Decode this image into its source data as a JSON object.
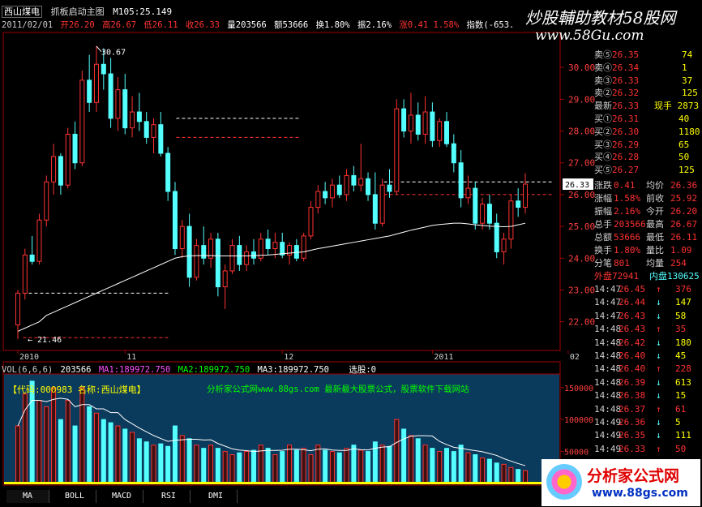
{
  "header": {
    "title": "西山煤电",
    "formula_name": "抓板启动主图",
    "ma_label": "M105:25.149",
    "date": "2011/02/01",
    "open": "开26.20",
    "high": "高26.67",
    "low": "低26.11",
    "close": "收26.33",
    "volume": "量203566",
    "amount": "额53666",
    "turnover": "换1.80%",
    "amplitude": "振2.16%",
    "change": "涨0.41",
    "change_pct": "1.58%",
    "index": "指数(-653."
  },
  "watermark": {
    "title": "炒股輔助教材58股网",
    "url": "www.58Gu.com",
    "brand": "分析家公式网",
    "brand_url": "www.88gs.com"
  },
  "chart_data": [
    {
      "type": "candlestick",
      "y_ticks": [
        "30.00",
        "29.00",
        "28.00",
        "27.00",
        "26.00",
        "25.00",
        "24.00",
        "23.00",
        "22.00"
      ],
      "x_ticks": [
        "2010",
        "11",
        "12",
        "2011",
        "02"
      ],
      "x_tick_index": [
        0,
        15,
        37,
        58,
        77
      ],
      "ylim": [
        21.2,
        31.0
      ],
      "extreme_labels": {
        "high": "30.67",
        "low": "21.46"
      },
      "current_price": "26.33",
      "ohlc": [
        [
          21.9,
          23.0,
          21.46,
          22.9
        ],
        [
          22.9,
          24.3,
          22.7,
          24.1
        ],
        [
          24.1,
          24.7,
          23.8,
          23.9
        ],
        [
          23.9,
          25.4,
          23.8,
          25.2
        ],
        [
          25.2,
          26.6,
          25.0,
          26.4
        ],
        [
          26.4,
          27.6,
          26.0,
          27.2
        ],
        [
          27.2,
          27.3,
          26.0,
          26.3
        ],
        [
          26.3,
          28.1,
          26.2,
          27.9
        ],
        [
          27.9,
          28.3,
          26.8,
          27.0
        ],
        [
          27.0,
          29.9,
          26.9,
          29.6
        ],
        [
          29.6,
          30.4,
          28.6,
          28.9
        ],
        [
          28.9,
          30.67,
          28.6,
          30.1
        ],
        [
          30.1,
          30.6,
          29.3,
          29.8
        ],
        [
          29.8,
          30.3,
          28.1,
          28.4
        ],
        [
          28.4,
          29.7,
          28.0,
          29.3
        ],
        [
          29.3,
          29.8,
          27.9,
          28.1
        ],
        [
          28.1,
          29.1,
          27.8,
          28.6
        ],
        [
          28.6,
          29.2,
          28.0,
          28.3
        ],
        [
          28.3,
          28.6,
          27.6,
          27.8
        ],
        [
          27.8,
          28.4,
          27.3,
          28.2
        ],
        [
          28.2,
          28.6,
          27.2,
          27.3
        ],
        [
          27.3,
          27.5,
          25.8,
          26.1
        ],
        [
          26.1,
          26.4,
          24.1,
          24.3
        ],
        [
          24.3,
          25.2,
          24.0,
          25.0
        ],
        [
          25.0,
          25.4,
          23.1,
          23.4
        ],
        [
          23.4,
          24.6,
          23.3,
          24.4
        ],
        [
          24.4,
          25.0,
          23.8,
          24.0
        ],
        [
          24.0,
          24.8,
          23.7,
          24.6
        ],
        [
          24.6,
          24.8,
          22.8,
          23.1
        ],
        [
          23.1,
          23.8,
          22.4,
          23.6
        ],
        [
          23.6,
          24.6,
          23.5,
          24.4
        ],
        [
          24.4,
          24.7,
          23.6,
          23.8
        ],
        [
          23.8,
          24.4,
          23.6,
          24.2
        ],
        [
          24.2,
          24.6,
          23.8,
          24.0
        ],
        [
          24.0,
          24.8,
          23.9,
          24.6
        ],
        [
          24.6,
          24.9,
          24.1,
          24.3
        ],
        [
          24.3,
          24.8,
          24.0,
          24.5
        ],
        [
          24.5,
          24.8,
          24.0,
          24.1
        ],
        [
          24.1,
          24.5,
          23.8,
          24.4
        ],
        [
          24.4,
          24.6,
          23.9,
          24.0
        ],
        [
          24.0,
          24.8,
          23.9,
          24.7
        ],
        [
          24.7,
          25.8,
          24.6,
          25.6
        ],
        [
          25.6,
          26.3,
          25.4,
          26.1
        ],
        [
          26.1,
          26.4,
          25.7,
          25.9
        ],
        [
          25.9,
          26.5,
          25.6,
          26.3
        ],
        [
          26.3,
          26.6,
          25.9,
          26.0
        ],
        [
          26.0,
          26.8,
          25.8,
          26.6
        ],
        [
          26.6,
          26.9,
          26.1,
          26.3
        ],
        [
          26.3,
          27.6,
          26.1,
          26.5
        ],
        [
          26.5,
          26.7,
          25.8,
          26.0
        ],
        [
          26.0,
          26.7,
          24.9,
          25.1
        ],
        [
          25.1,
          26.5,
          25.0,
          26.3
        ],
        [
          26.3,
          26.8,
          25.9,
          26.1
        ],
        [
          26.1,
          29.0,
          26.0,
          28.7
        ],
        [
          28.7,
          29.0,
          27.8,
          28.0
        ],
        [
          28.0,
          29.2,
          27.6,
          28.5
        ],
        [
          28.5,
          28.9,
          27.7,
          27.9
        ],
        [
          27.9,
          29.1,
          27.6,
          28.6
        ],
        [
          28.6,
          28.9,
          27.5,
          27.7
        ],
        [
          27.7,
          28.4,
          27.5,
          28.3
        ],
        [
          28.3,
          28.6,
          27.5,
          27.6
        ],
        [
          27.6,
          27.9,
          26.7,
          27.0
        ],
        [
          27.0,
          27.4,
          25.6,
          25.9
        ],
        [
          25.9,
          26.6,
          25.7,
          26.2
        ],
        [
          26.2,
          26.4,
          24.9,
          25.1
        ],
        [
          25.1,
          25.9,
          24.9,
          25.7
        ],
        [
          25.7,
          26.0,
          24.9,
          25.1
        ],
        [
          25.1,
          25.4,
          24.0,
          24.2
        ],
        [
          24.2,
          24.8,
          23.8,
          24.6
        ],
        [
          24.6,
          26.0,
          24.3,
          25.8
        ],
        [
          25.8,
          26.2,
          25.3,
          25.6
        ],
        [
          25.6,
          26.67,
          25.4,
          26.33
        ]
      ],
      "ma105": [
        21.7,
        21.8,
        21.9,
        22.0,
        22.2,
        22.3,
        22.4,
        22.5,
        22.6,
        22.7,
        22.8,
        22.9,
        23.0,
        23.1,
        23.2,
        23.3,
        23.4,
        23.5,
        23.6,
        23.7,
        23.8,
        23.9,
        24.0,
        24.05,
        24.07,
        24.08,
        24.08,
        24.08,
        24.07,
        24.07,
        24.07,
        24.07,
        24.07,
        24.08,
        24.09,
        24.1,
        24.12,
        24.14,
        24.16,
        24.18,
        24.2,
        24.25,
        24.3,
        24.34,
        24.38,
        24.42,
        24.46,
        24.5,
        24.54,
        24.58,
        24.62,
        24.66,
        24.7,
        24.76,
        24.82,
        24.88,
        24.93,
        24.98,
        25.03,
        25.06,
        25.08,
        25.1,
        25.1,
        25.08,
        25.05,
        25.03,
        25.01,
        25.0,
        24.99,
        25.0,
        25.05,
        25.1
      ],
      "dashed_levels": [
        {
          "value": 28.4,
          "color": "#ffffff",
          "from": 47,
          "to": 83
        },
        {
          "value": 27.8,
          "color": "#ff3030",
          "from": 47,
          "to": 83
        },
        {
          "value": 26.4,
          "color": "#ffffff",
          "from": 108,
          "to": 158
        },
        {
          "value": 26.0,
          "color": "#ff3030",
          "from": 108,
          "to": 158
        },
        {
          "value": 22.9,
          "color": "#ffffff",
          "from": 2,
          "to": 45
        },
        {
          "value": 21.5,
          "color": "#ff3030",
          "from": 2,
          "to": 45
        }
      ]
    },
    {
      "type": "bar",
      "title": "VOL(6,6,6)",
      "volume": "203566",
      "ma1": "MA1:189972.750",
      "ma2": "MA2:189972.750",
      "ma3": "MA3:189972.750",
      "extra": "选股:0",
      "stock_code": "【代码:000983 名称:西山煤电】",
      "ad_text": "分析家公式网www.88gs.com 最新最大股票公式，股票软件下载网站",
      "y_ticks": [
        "150000",
        "100000",
        "50000"
      ],
      "ylim": [
        0,
        170000
      ],
      "values": [
        90000,
        140000,
        160000,
        130000,
        120000,
        150000,
        100000,
        130000,
        90000,
        150000,
        120000,
        110000,
        100000,
        95000,
        90000,
        85000,
        80000,
        70000,
        65000,
        60000,
        62000,
        58000,
        90000,
        75000,
        70000,
        60000,
        55000,
        60000,
        55000,
        50000,
        45000,
        48000,
        50000,
        52000,
        60000,
        55000,
        45000,
        50000,
        60000,
        52000,
        55000,
        45000,
        60000,
        52000,
        50000,
        48000,
        55000,
        60000,
        52000,
        50000,
        65000,
        60000,
        58000,
        100000,
        85000,
        75000,
        70000,
        60000,
        55000,
        50000,
        55000,
        50000,
        60000,
        48000,
        45000,
        40000,
        38000,
        32000,
        30000,
        25000,
        22000,
        20000
      ],
      "tabs": [
        "MA",
        "BOLL",
        "MACD",
        "RSI",
        "DMI"
      ]
    }
  ],
  "quote": {
    "sell": [
      {
        "label": "卖⑤",
        "price": "26.35",
        "vol": "74"
      },
      {
        "label": "卖④",
        "price": "26.34",
        "vol": "1"
      },
      {
        "label": "卖③",
        "price": "26.33",
        "vol": "37"
      },
      {
        "label": "卖②",
        "price": "26.32",
        "vol": "125"
      },
      {
        "label": "最新",
        "price": "26.33",
        "vol": "现手 2873"
      }
    ],
    "buy": [
      {
        "label": "买①",
        "price": "26.31",
        "vol": "40"
      },
      {
        "label": "买②",
        "price": "26.30",
        "vol": "1180"
      },
      {
        "label": "买③",
        "price": "26.29",
        "vol": "65"
      },
      {
        "label": "买④",
        "price": "26.28",
        "vol": "50"
      },
      {
        "label": "买⑤",
        "price": "26.27",
        "vol": "125"
      }
    ],
    "stats": [
      [
        "涨跌",
        "0.41",
        "均价",
        "26.36"
      ],
      [
        "涨幅",
        "1.58%",
        "前收",
        "25.92"
      ],
      [
        "振幅",
        "2.16%",
        "今开",
        "26.20"
      ],
      [
        "总手",
        "203566",
        "最高",
        "26.67"
      ],
      [
        "总额",
        "53666",
        "最低",
        "26.11"
      ],
      [
        "换手",
        "1.80%",
        "量比",
        "1.09"
      ],
      [
        "分笔",
        "801",
        "均量",
        "254"
      ]
    ],
    "outer": "外盘72941",
    "inner": "内盘130625",
    "ticks": [
      [
        "14:47",
        "26.45",
        "376"
      ],
      [
        "14:47",
        "26.44",
        "147"
      ],
      [
        "14:47",
        "26.43",
        "58"
      ],
      [
        "14:48",
        "26.43",
        "35"
      ],
      [
        "14:48",
        "26.42",
        "180"
      ],
      [
        "14:48",
        "26.40",
        "45"
      ],
      [
        "14:48",
        "26.40",
        "228"
      ],
      [
        "14:48",
        "26.39",
        "613"
      ],
      [
        "14:48",
        "26.38",
        "15"
      ],
      [
        "14:48",
        "26.37",
        "61"
      ],
      [
        "14:49",
        "26.36",
        "5"
      ],
      [
        "14:49",
        "26.35",
        "111"
      ],
      [
        "14:49",
        "26.33",
        "50"
      ]
    ],
    "tick_dirs": [
      "up",
      "down",
      "down",
      "up",
      "down",
      "down",
      "up",
      "down",
      "down",
      "up",
      "down",
      "down",
      "up"
    ]
  },
  "colors": {
    "up": "#ff3232",
    "down": "#54ffff",
    "ma": "#ffffff",
    "grid": "#a00000",
    "text_yellow": "#ffff00",
    "text_green": "#00ff00"
  }
}
